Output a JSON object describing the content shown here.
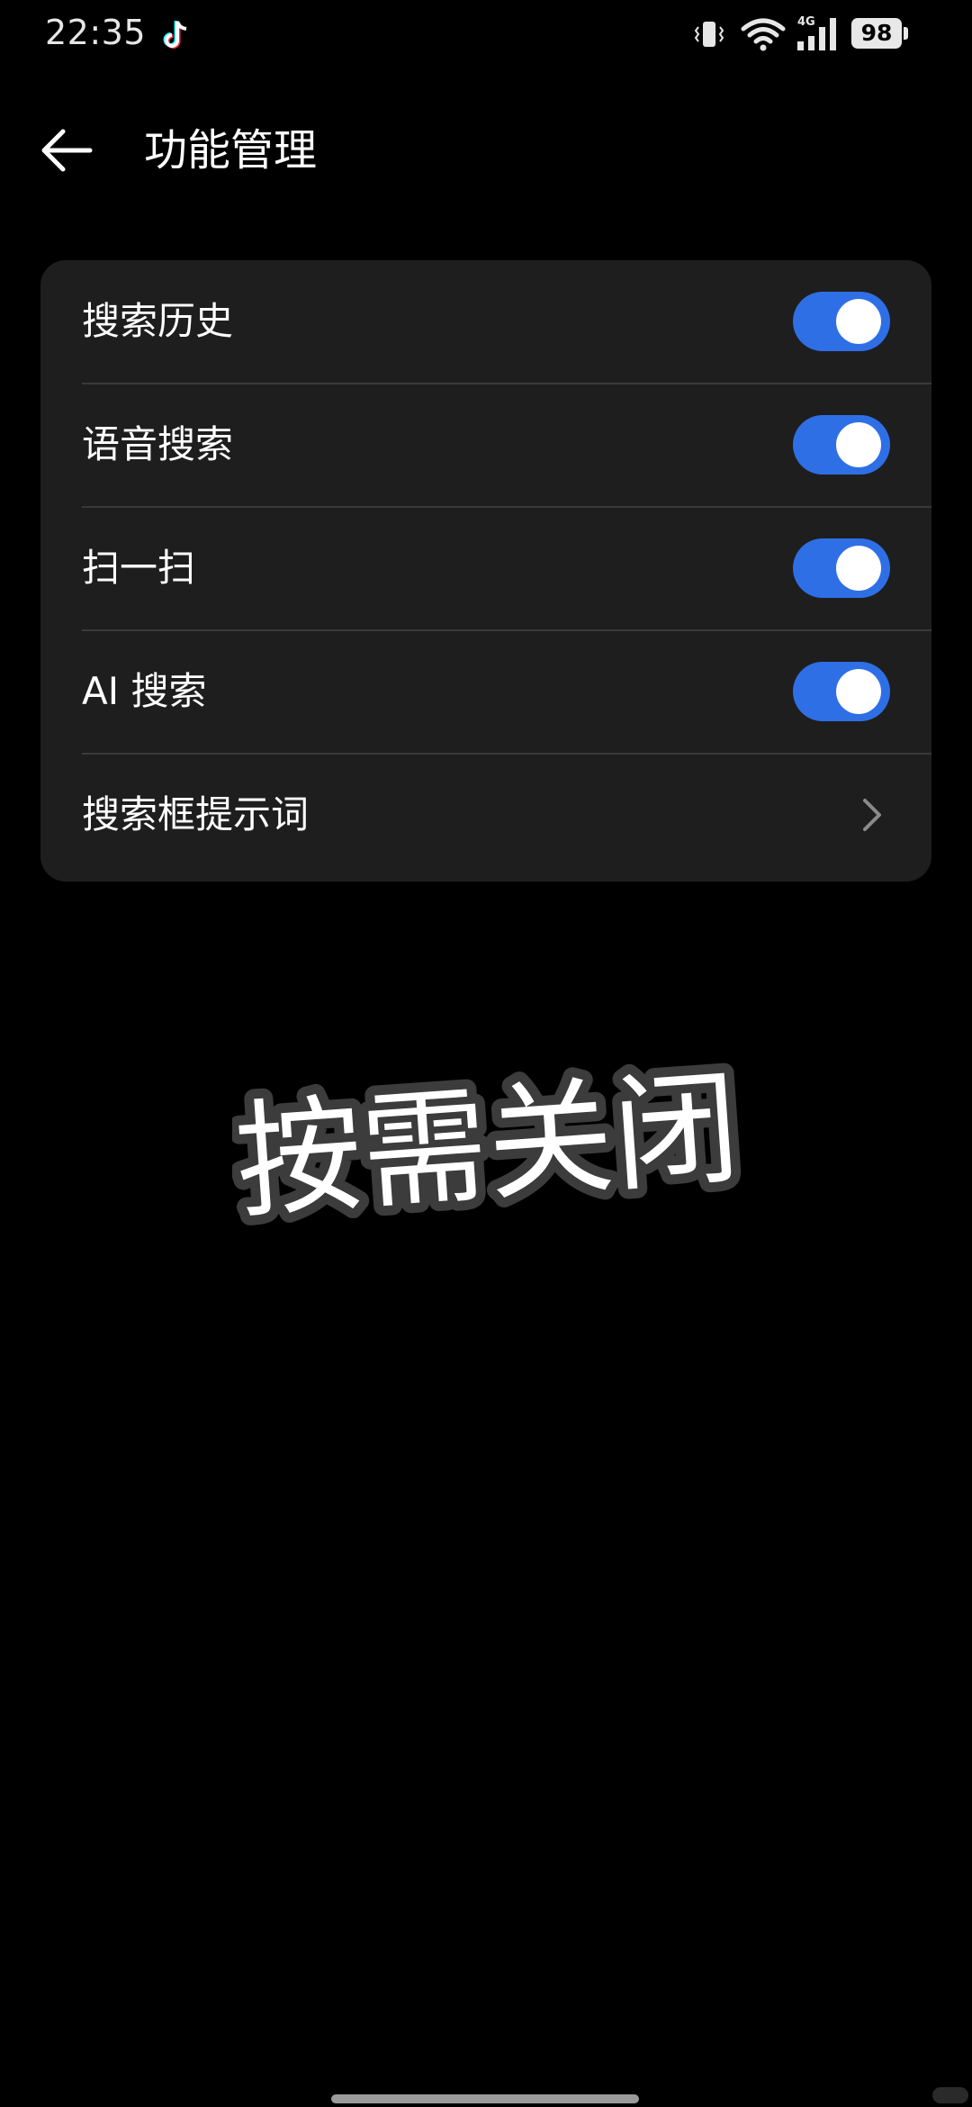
{
  "status_bar": {
    "time": "22:35",
    "battery_level": "98",
    "network_type": "4G"
  },
  "header": {
    "title": "功能管理"
  },
  "settings": {
    "items": [
      {
        "label": "搜索历史",
        "control": "toggle",
        "enabled": true
      },
      {
        "label": "语音搜索",
        "control": "toggle",
        "enabled": true
      },
      {
        "label": "扫一扫",
        "control": "toggle",
        "enabled": true
      },
      {
        "label": "AI 搜索",
        "control": "toggle",
        "enabled": true
      },
      {
        "label": "搜索框提示词",
        "control": "chevron"
      }
    ]
  },
  "overlay": {
    "caption": "按需关闭"
  },
  "colors": {
    "background": "#000000",
    "card": "#1e1e1e",
    "toggle_on": "#2f6fe6",
    "divider": "#3a3a3a"
  }
}
